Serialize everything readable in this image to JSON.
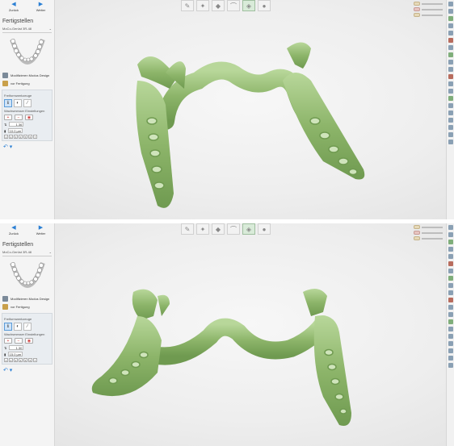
{
  "nav": {
    "back_label": "Zurück",
    "next_label": "Weiter"
  },
  "step_title": "Fertigstellen",
  "material": "MoCo-Gerüst 3R-48",
  "actions": {
    "modify_design": "Modifizieren Modus Design",
    "before_finish": "vor Fertigung"
  },
  "freeform": {
    "label": "Freiformwerkzeuge",
    "wax_label": "Wachsmesser Einstellungen",
    "thickness_top": "1.36 mm",
    "strength_top": "10.0 µm",
    "thickness_bottom": "1.30 mm",
    "strength_bottom": "15.0 µm",
    "sizes": [
      "1",
      "2",
      "3",
      "4",
      "5",
      "6",
      "7"
    ]
  },
  "icons": {
    "undo": "undo-icon",
    "toolbar": [
      "wax-knife-icon",
      "smooth-icon",
      "add-material-icon",
      "cut-icon",
      "model-view-icon",
      "sphere-icon"
    ]
  },
  "colors": {
    "model_green": "#8db56a",
    "accent_blue": "#2a7fd4"
  }
}
